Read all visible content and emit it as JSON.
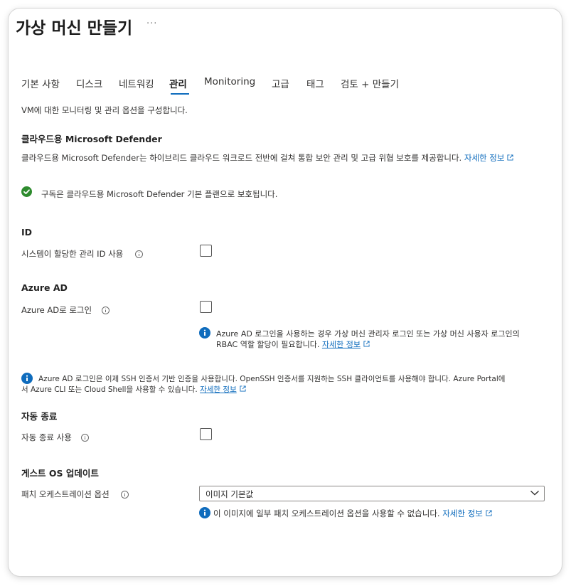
{
  "title": "가상 머신 만들기",
  "more_label": "···",
  "tabs": [
    {
      "label": "기본 사항"
    },
    {
      "label": "디스크"
    },
    {
      "label": "네트워킹"
    },
    {
      "label": "관리",
      "active": true
    },
    {
      "label": "Monitoring"
    },
    {
      "label": "고급"
    },
    {
      "label": "태그"
    },
    {
      "label": "검토 + 만들기"
    }
  ],
  "intro": "VM에 대한 모니터링 및 관리 옵션을 구성합니다.",
  "defender": {
    "heading": "클라우드용 Microsoft Defender",
    "description": "클라우드용 Microsoft Defender는 하이브리드 클라우드 워크로드 전반에 걸쳐 통합 보안 관리 및 고급 위협 보호를 제공합니다.",
    "link": "자세한 정보",
    "status": "구독은 클라우드용 Microsoft Defender 기본 플랜으로 보호됩니다."
  },
  "identity": {
    "heading": "ID",
    "field_label": "시스템이 할당한 관리 ID 사용",
    "checked": false
  },
  "azure_ad": {
    "heading": "Azure AD",
    "field_label": "Azure AD로 로그인",
    "checked": false,
    "info_line1": "Azure AD 로그인을 사용하는 경우 가상 머신 관리자 로그인 또는 가상 머신 사용자 로그인의",
    "info_line2": "RBAC 역할 할당이 필요합니다.",
    "info_link": "자세한 정보"
  },
  "ssh_notice": {
    "line1": "Azure AD 로그인은 이제 SSH 인증서 기반 인증을 사용합니다. OpenSSH 인증서를 지원하는 SSH 클라이언트를 사용해야 합니다. Azure Portal에",
    "line2": "서 Azure CLI 또는 Cloud Shell을 사용할 수 있습니다.",
    "link": "자세한 정보"
  },
  "auto_shutdown": {
    "heading": "자동 종료",
    "field_label": "자동 종료 사용",
    "checked": false
  },
  "guest_os": {
    "heading": "게스트 OS 업데이트",
    "field_label": "패치 오케스트레이션 옵션",
    "selected": "이미지 기본값",
    "info": "이 이미지에 일부 패치 오케스트레이션 옵션을 사용할 수 없습니다.",
    "link": "자세한 정보"
  },
  "colors": {
    "accent": "#0f6cbd",
    "success": "#2e8b2e"
  },
  "icons": [
    "more-icon",
    "check-circle-icon",
    "info-tooltip-icon",
    "info-icon",
    "external-link-icon",
    "chevron-down-icon"
  ]
}
